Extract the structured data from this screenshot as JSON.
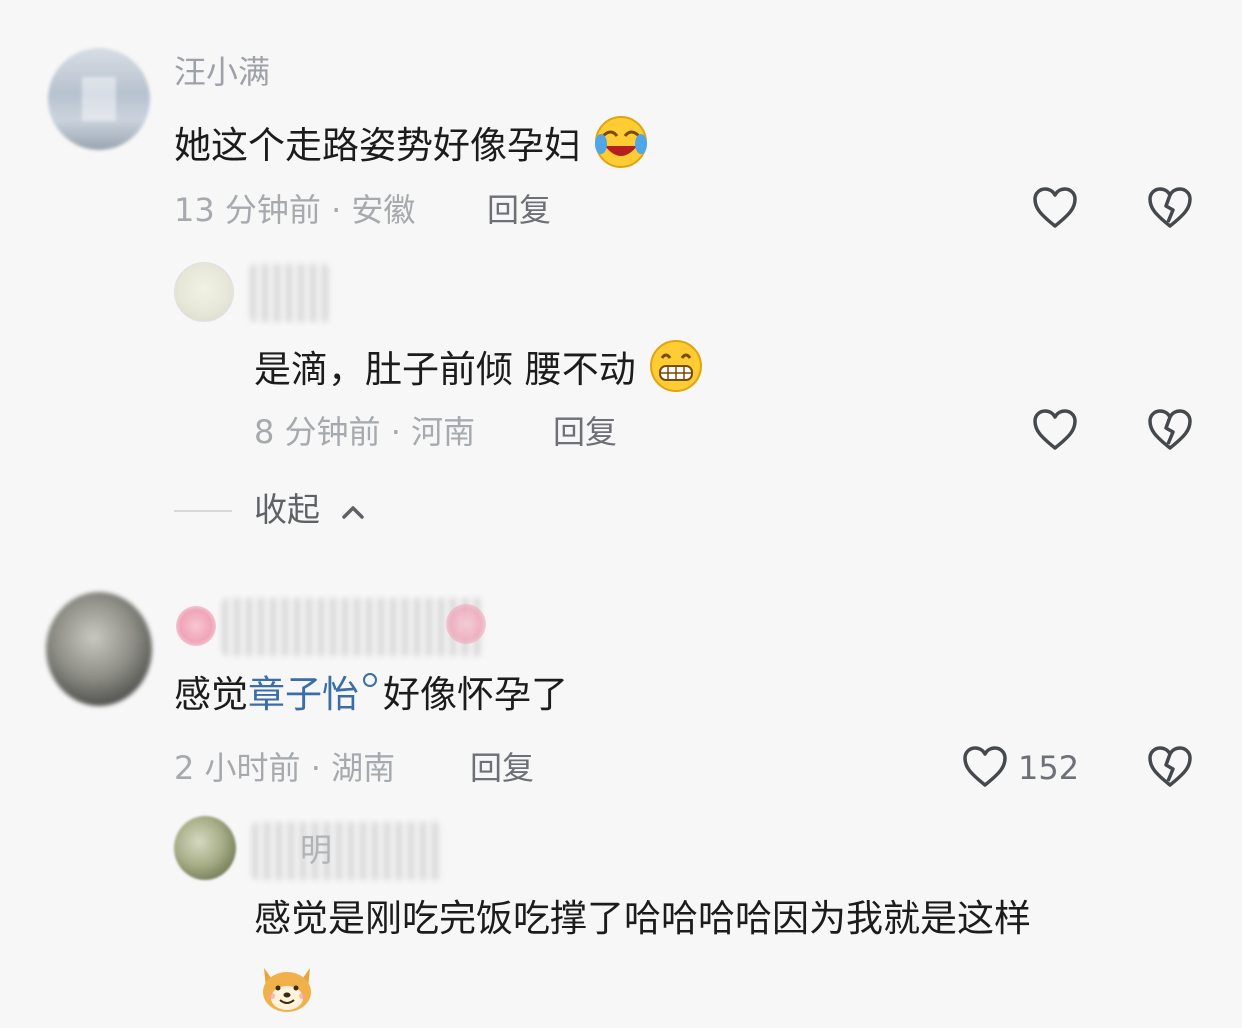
{
  "comments": [
    {
      "username": "汪小满",
      "text": "她这个走路姿势好像孕妇",
      "emoji": "laughing-crying-emoji",
      "time": "13 分钟前",
      "location": "安徽",
      "reply_label": "回复",
      "replies": [
        {
          "text": "是滴，肚子前倾 腰不动",
          "emoji": "grinning-emoji",
          "time": "8 分钟前",
          "location": "河南",
          "reply_label": "回复"
        }
      ],
      "collapse_label": "收起"
    },
    {
      "text_before": "感觉",
      "mention": "章子怡",
      "text_after": "好像怀孕了",
      "time": "2 小时前",
      "location": "湖南",
      "reply_label": "回复",
      "like_count": "152",
      "replies": [
        {
          "username_fragment": "明",
          "text": "感觉是刚吃完饭吃撑了哈哈哈哈因为我就是这样",
          "emoji": "shiba-dog-emoji"
        }
      ]
    }
  ]
}
